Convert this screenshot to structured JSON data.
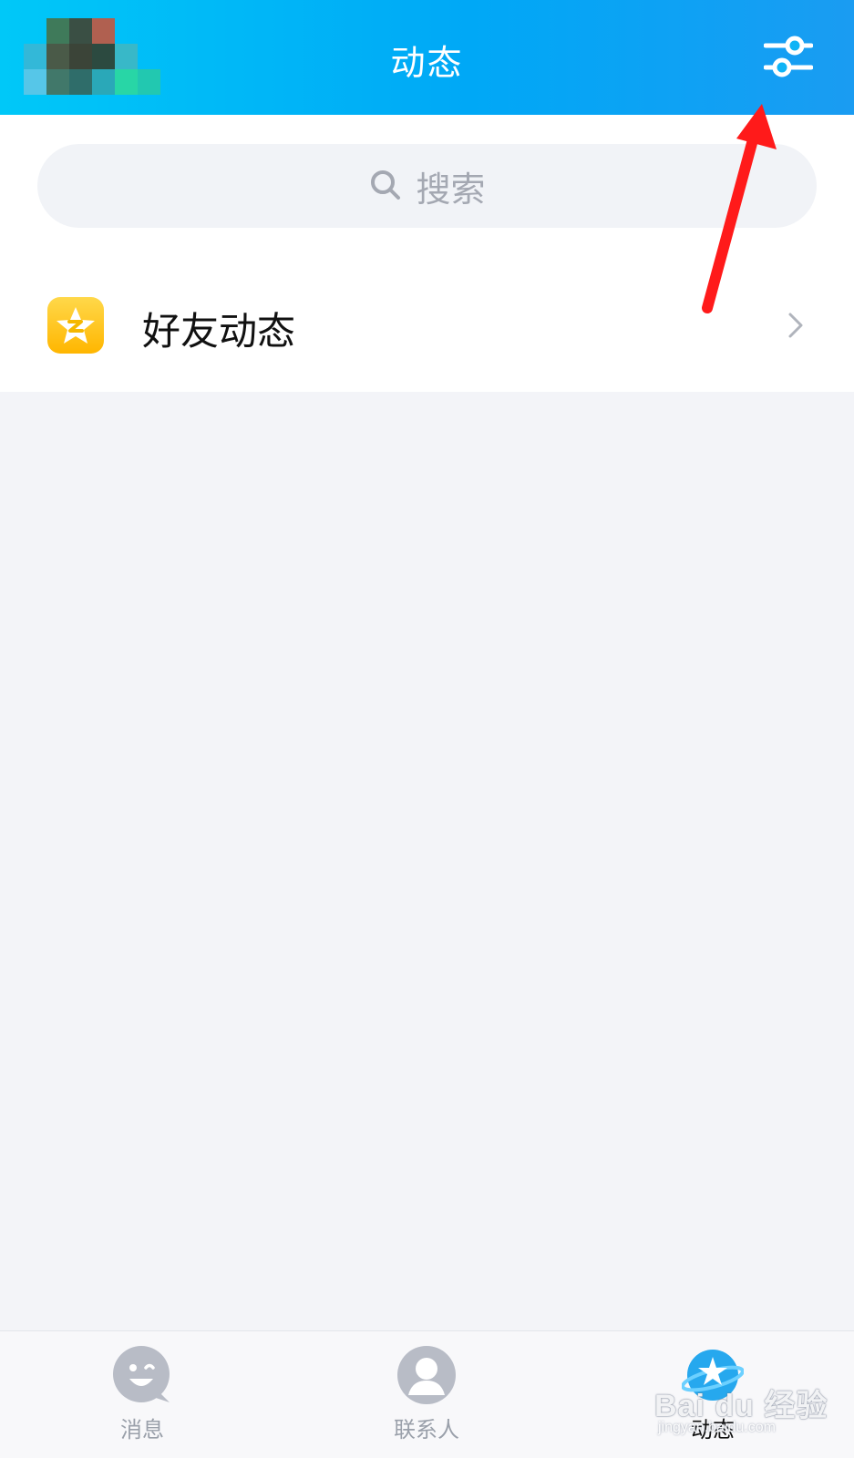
{
  "header": {
    "title": "动态",
    "avatar_icon": "avatar-pixelated",
    "filter_icon": "sliders-icon"
  },
  "search": {
    "placeholder": "搜索",
    "icon": "search-icon"
  },
  "feed": {
    "items": [
      {
        "label": "好友动态",
        "icon": "qzone-star-icon"
      }
    ]
  },
  "tabs": [
    {
      "label": "消息",
      "icon": "chat-bubble-icon",
      "active": false
    },
    {
      "label": "联系人",
      "icon": "contact-person-icon",
      "active": false
    },
    {
      "label": "动态",
      "icon": "planet-star-icon",
      "active": true
    }
  ],
  "watermark": {
    "brand": "Bai du 经验",
    "url": "jingyan.baidu.com"
  },
  "colors": {
    "header_start": "#00c8f8",
    "header_end": "#1a9cf2",
    "background": "#f3f4f8",
    "annotation_arrow": "#ff1a1a"
  }
}
